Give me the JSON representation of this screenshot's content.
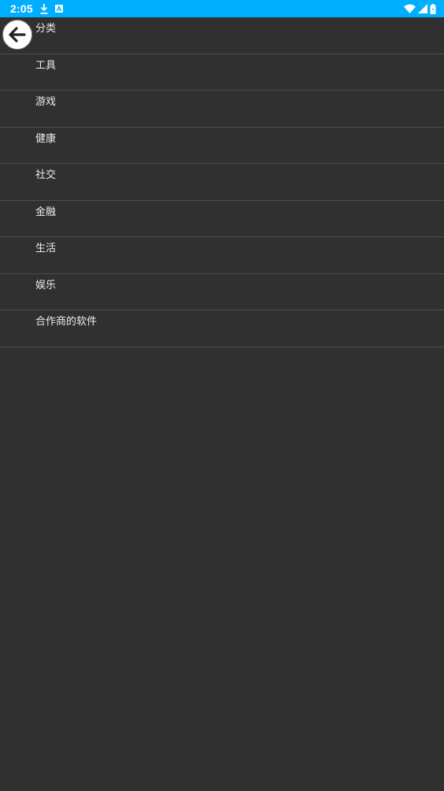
{
  "status_bar": {
    "time": "2:05",
    "background_color": "#00AEFF",
    "left_icons": [
      "download-icon",
      "a-badge-icon"
    ],
    "right_icons": [
      "wifi-icon",
      "signal-icon",
      "battery-icon"
    ]
  },
  "back_button": {
    "icon": "arrow-left-icon"
  },
  "categories": {
    "items": [
      {
        "label": "分类"
      },
      {
        "label": "工具"
      },
      {
        "label": "游戏"
      },
      {
        "label": "健康"
      },
      {
        "label": "社交"
      },
      {
        "label": "金融"
      },
      {
        "label": "生活"
      },
      {
        "label": "娱乐"
      },
      {
        "label": "合作商的软件"
      }
    ]
  }
}
